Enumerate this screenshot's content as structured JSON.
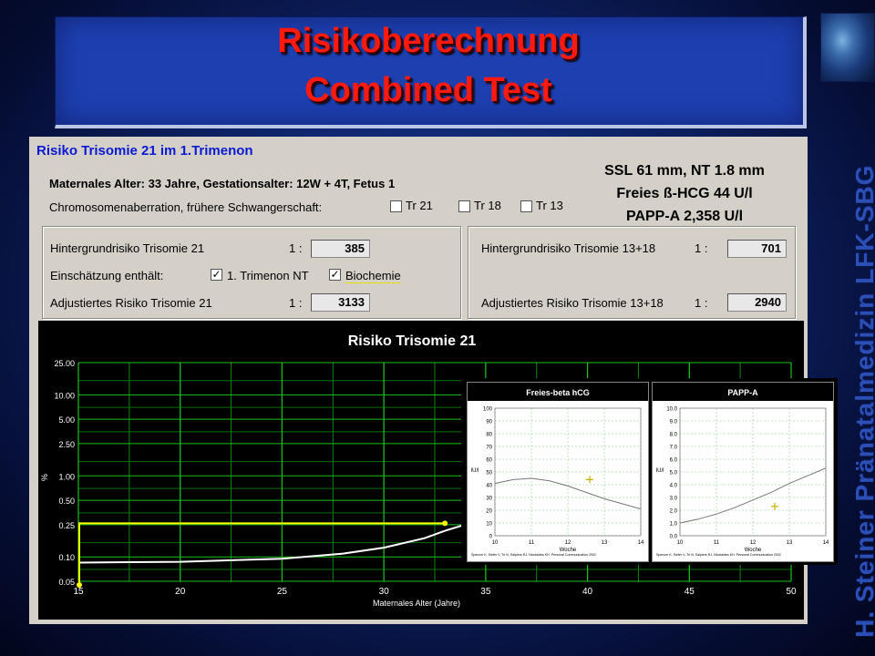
{
  "title": {
    "line1": "Risikoberechnung",
    "line2": "Combined Test"
  },
  "side_text": "H. Steiner  Pränatalmedizin  LFK-SBG",
  "panel": {
    "title": "Risiko Trisomie 21 im 1.Trimenon",
    "maternal_line": "Maternales Alter: 33 Jahre,  Gestationsalter: 12W + 4T,  Fetus 1",
    "chrom_label": "Chromosomenaberration, frühere Schwangerschaft:",
    "chrom_options": [
      "Tr 21",
      "Tr 18",
      "Tr 13"
    ],
    "info": {
      "ssl": "SSL 61 mm, NT 1.8 mm",
      "hcg": "Freies ß-HCG  44 U/l",
      "pappa": "PAPP-A  2,358 U/l"
    },
    "left_group": {
      "bg_label": "Hintergrundrisiko Trisomie 21",
      "bg_ratio": "1 :",
      "bg_value": "385",
      "incl_label": "Einschätzung enthält:",
      "incl_nt": "1. Trimenon NT",
      "incl_bio": "Biochemie",
      "adj_label": "Adjustiertes Risiko Trisomie 21",
      "adj_ratio": "1 :",
      "adj_value": "3133"
    },
    "right_group": {
      "bg_label": "Hintergrundrisiko Trisomie 13+18",
      "bg_ratio": "1 :",
      "bg_value": "701",
      "adj_label": "Adjustiertes Risiko Trisomie 13+18",
      "adj_ratio": "1 :",
      "adj_value": "2940"
    }
  },
  "chart_data": [
    {
      "type": "line",
      "title": "Risiko Trisomie 21",
      "xlabel": "Maternales Alter (Jahre)",
      "ylabel": "%",
      "x_ticks": [
        15,
        20,
        25,
        30,
        35,
        40,
        45,
        50
      ],
      "y_ticks": [
        "0.05",
        "0.10",
        "0.25",
        "0.50",
        "1.00",
        "2.50",
        "5.00",
        "10.00",
        "25.00"
      ],
      "y_scale": "log",
      "xlim": [
        15,
        50
      ],
      "ylim": [
        0.05,
        25
      ],
      "grid": true,
      "series": [
        {
          "name": "",
          "color": "#ffffff",
          "x": [
            15,
            20,
            25,
            28,
            30,
            32,
            33,
            35,
            37,
            40,
            42,
            45,
            48,
            50
          ],
          "y": [
            0.085,
            0.087,
            0.095,
            0.11,
            0.13,
            0.17,
            0.21,
            0.3,
            0.45,
            0.9,
            1.5,
            3.0,
            7,
            14
          ]
        }
      ],
      "marker": {
        "x": 33,
        "y": 0.26,
        "color": "#ffff00"
      }
    },
    {
      "type": "line",
      "title": "Freies-beta hCG",
      "xlabel": "Woche",
      "ylabel": "IU/l",
      "x_ticks": [
        "10",
        "11",
        "12",
        "13",
        "14"
      ],
      "y_ticks": [
        "0",
        "10",
        "20",
        "30",
        "40",
        "50",
        "60",
        "70",
        "80",
        "90",
        "100"
      ],
      "xlim": [
        10,
        14
      ],
      "ylim": [
        0,
        100
      ],
      "series": [
        {
          "name": "",
          "x": [
            10,
            10.5,
            11,
            11.5,
            12,
            12.5,
            13,
            13.5,
            14
          ],
          "y": [
            41,
            44,
            45,
            43,
            39,
            34,
            29,
            25,
            21
          ]
        }
      ],
      "marker": {
        "x": 12.6,
        "y": 44
      },
      "footnote": "Spencer K, Siefer V, Tri N, Salpiers RJ, Nicolaides KH. Personal Communication 2002"
    },
    {
      "type": "line",
      "title": "PAPP-A",
      "xlabel": "Woche",
      "ylabel": "IU/l",
      "x_ticks": [
        "10",
        "11",
        "12",
        "13",
        "14"
      ],
      "y_ticks": [
        "0.0",
        "1.0",
        "2.0",
        "3.0",
        "4.0",
        "5.0",
        "6.0",
        "7.0",
        "8.0",
        "9.0",
        "10.0"
      ],
      "xlim": [
        10,
        14
      ],
      "ylim": [
        0,
        10
      ],
      "series": [
        {
          "name": "",
          "x": [
            10,
            10.5,
            11,
            11.5,
            12,
            12.5,
            13,
            13.5,
            14
          ],
          "y": [
            1.0,
            1.3,
            1.7,
            2.2,
            2.8,
            3.4,
            4.1,
            4.7,
            5.3
          ]
        }
      ],
      "marker": {
        "x": 12.6,
        "y": 2.3
      },
      "footnote": "Spencer K, Siefer V, Tri N, Salpiers RJ, Nicolaides KH. Personal Communication 2002"
    }
  ]
}
